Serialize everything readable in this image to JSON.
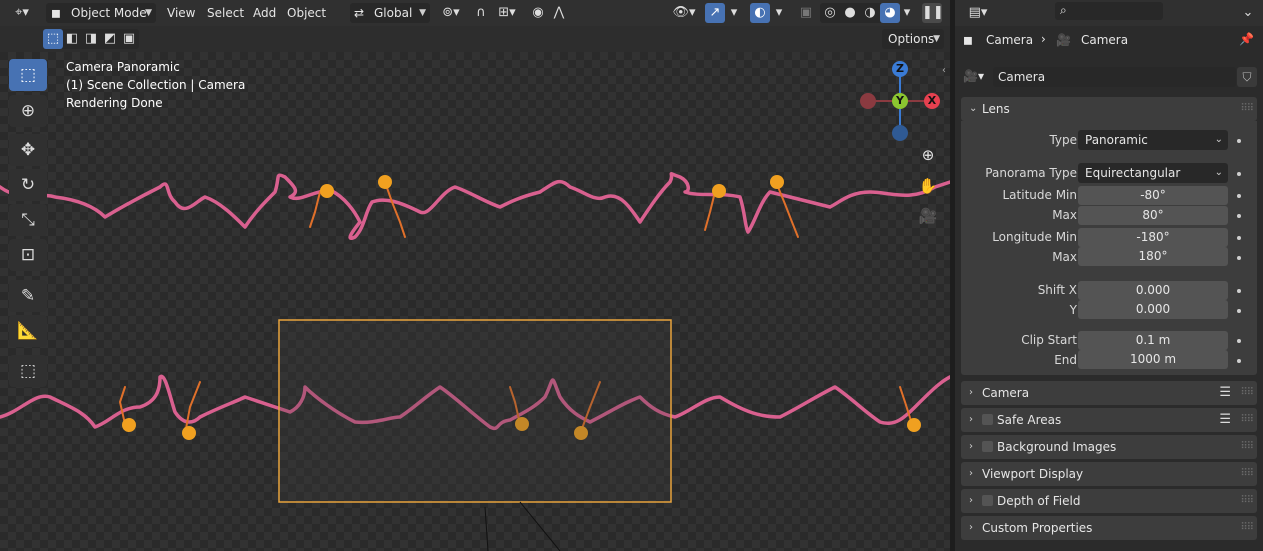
{
  "viewport_header": {
    "mode": "Object Mode",
    "menus": [
      "View",
      "Select",
      "Add",
      "Object"
    ],
    "orientation": "Global",
    "options_label": "Options"
  },
  "overlay": {
    "line1": "Camera Panoramic",
    "line2": "(1) Scene Collection | Camera",
    "line3": "Rendering Done"
  },
  "gizmo": {
    "z": "Z",
    "y": "Y",
    "x": "X"
  },
  "toolbar": {
    "tools": [
      "select-box-icon",
      "cursor-icon",
      "move-icon",
      "rotate-icon",
      "scale-icon",
      "transform-icon",
      "annotate-icon",
      "measure-icon",
      "add-cube-icon"
    ]
  },
  "properties": {
    "breadcrumb": [
      "Camera",
      "Camera"
    ],
    "datablock": "Camera",
    "lens": {
      "title": "Lens",
      "type_label": "Type",
      "type_value": "Panoramic",
      "pano_label": "Panorama Type",
      "pano_value": "Equirectangular",
      "lat_min_label": "Latitude Min",
      "lat_min": "-80°",
      "lat_max_label": "Max",
      "lat_max": "80°",
      "lon_min_label": "Longitude Min",
      "lon_min": "-180°",
      "lon_max_label": "Max",
      "lon_max": "180°",
      "shiftx_label": "Shift X",
      "shiftx": "0.000",
      "shifty_label": "Y",
      "shifty": "0.000",
      "clip_start_label": "Clip Start",
      "clip_start": "0.1 m",
      "clip_end_label": "End",
      "clip_end": "1000 m"
    },
    "panels": [
      "Camera",
      "Safe Areas",
      "Background Images",
      "Viewport Display",
      "Depth of Field",
      "Custom Properties"
    ]
  },
  "colors": {
    "accent": "#4772b3",
    "camera_frame": "#e8a33d",
    "string": "#d9608f",
    "flower": "#f0a020",
    "axis_x": "#e5404f",
    "axis_y": "#8bc630",
    "axis_z": "#3a7bd5"
  }
}
